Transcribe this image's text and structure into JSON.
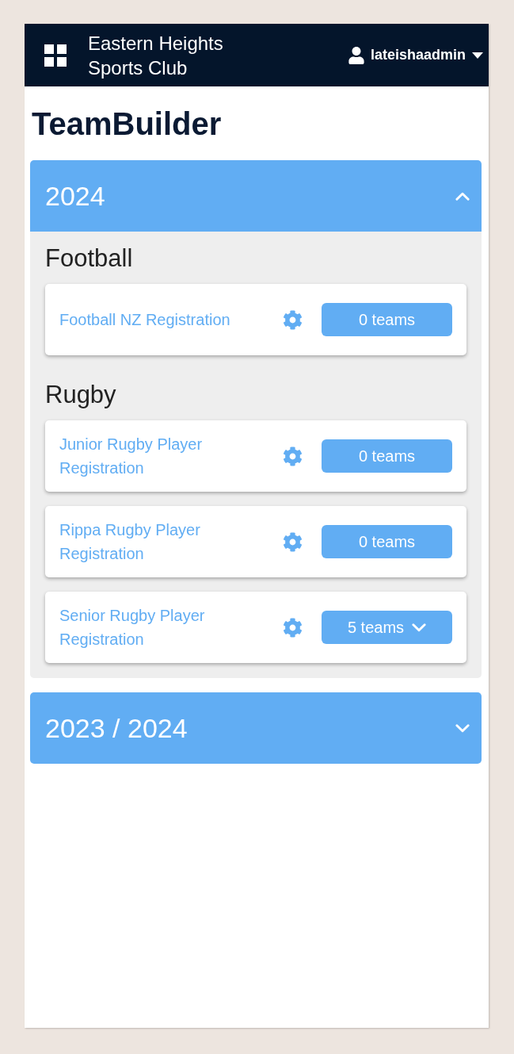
{
  "header": {
    "club_name": "Eastern Heights Sports Club",
    "user": "lateishaadmin"
  },
  "title": "TeamBuilder",
  "seasons": [
    {
      "label": "2024",
      "expanded": true,
      "sports": [
        {
          "name": "Football",
          "registrations": [
            {
              "name": "Football NZ Registration",
              "teams": "0 teams",
              "has_dropdown": false
            }
          ]
        },
        {
          "name": "Rugby",
          "registrations": [
            {
              "name": "Junior Rugby Player Registration",
              "teams": "0 teams",
              "has_dropdown": false
            },
            {
              "name": "Rippa Rugby Player Registration",
              "teams": "0 teams",
              "has_dropdown": false
            },
            {
              "name": "Senior Rugby Player Registration",
              "teams": "5 teams",
              "has_dropdown": true
            }
          ]
        }
      ]
    },
    {
      "label": "2023 / 2024",
      "expanded": false
    }
  ]
}
